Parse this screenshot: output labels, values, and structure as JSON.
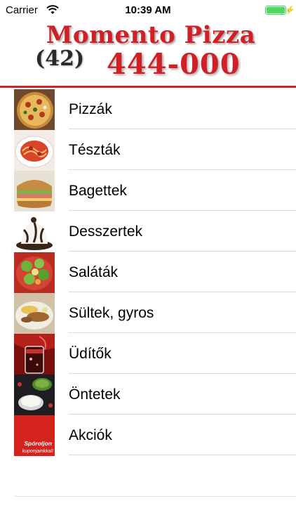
{
  "status_bar": {
    "carrier": "Carrier",
    "time": "10:39 AM"
  },
  "header": {
    "title": "Momento Pizza",
    "area_code": "(42)",
    "phone": "444-000",
    "brand_color": "#d11f26"
  },
  "menu": {
    "items": [
      {
        "label": "Pizzák",
        "icon": "pizza-icon"
      },
      {
        "label": "Tészták",
        "icon": "pasta-icon"
      },
      {
        "label": "Bagettek",
        "icon": "baguette-icon"
      },
      {
        "label": "Desszertek",
        "icon": "dessert-icon"
      },
      {
        "label": "Saláták",
        "icon": "salad-icon"
      },
      {
        "label": "Sültek, gyros",
        "icon": "roast-icon"
      },
      {
        "label": "Üdítők",
        "icon": "drink-icon"
      },
      {
        "label": "Öntetek",
        "icon": "sauce-icon"
      },
      {
        "label": "Akciók",
        "icon": "promo-icon"
      }
    ],
    "promo_line1": "Spóroljon",
    "promo_line2": "kuponjainkkal!"
  }
}
